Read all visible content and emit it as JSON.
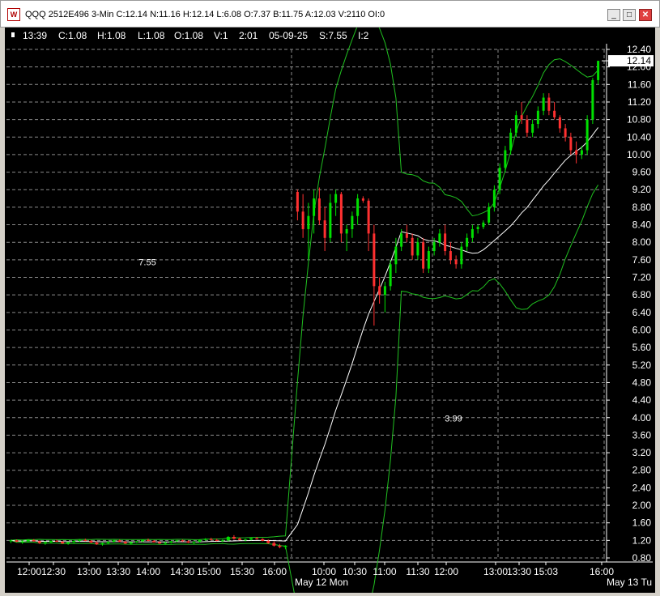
{
  "window": {
    "title": "QQQ 2512E496 3-Min C:12.14 N:11.16 H:12.14 L:6.08 O:7.37 B:11.75 A:12.03 V:2110 OI:0",
    "icon_letter": "W",
    "minimize_label": "_",
    "maximize_label": "□",
    "close_label": "✕"
  },
  "infobar": {
    "time": "13:39",
    "close": "C:1.08",
    "high": "H:1.08",
    "low": "L:1.08",
    "open": "O:1.08",
    "volume": "V:1",
    "bar_time": "2:01",
    "date": "05-09-25",
    "strike": "S:7.55",
    "interval": "I:2"
  },
  "colors": {
    "background": "#000000",
    "grid": "#8a8a8a",
    "up_bar": "#00e000",
    "down_bar": "#ff3030",
    "band": "#20c020",
    "average": "#ffffff"
  },
  "chart_data": {
    "type": "candlestick",
    "title": "",
    "ylim": [
      0.8,
      12.4
    ],
    "y_ticks": [
      "12.40",
      "12.00",
      "11.60",
      "11.20",
      "10.80",
      "10.40",
      "10.00",
      "9.60",
      "9.20",
      "8.80",
      "8.40",
      "8.00",
      "7.60",
      "7.20",
      "6.80",
      "6.40",
      "6.00",
      "5.60",
      "5.20",
      "4.80",
      "4.40",
      "4.00",
      "3.60",
      "3.20",
      "2.80",
      "2.40",
      "2.00",
      "1.60",
      "1.20",
      "0.80"
    ],
    "last_price": "12.14",
    "x_ticks": [
      "12:00",
      "12:30",
      "13:00",
      "13:30",
      "14:00",
      "14:30",
      "15:00",
      "15:30",
      "16:00",
      "10:00",
      "10:30",
      "11:00",
      "11:30",
      "12:00",
      "13:00",
      "13:30",
      "15:03",
      "16:00"
    ],
    "day_labels": [
      "May 12 Mon",
      "May 13 Tu"
    ],
    "annotations": [
      "7.55",
      "3.99"
    ],
    "annotation_values": [
      7.55,
      3.99
    ],
    "bars": [
      [
        1.18,
        1.22,
        1.14,
        1.2
      ],
      [
        1.2,
        1.22,
        1.16,
        1.17
      ],
      [
        1.16,
        1.2,
        1.12,
        1.18
      ],
      [
        1.18,
        1.22,
        1.15,
        1.21
      ],
      [
        1.21,
        1.23,
        1.17,
        1.18
      ],
      [
        1.18,
        1.2,
        1.12,
        1.14
      ],
      [
        1.14,
        1.18,
        1.1,
        1.16
      ],
      [
        1.16,
        1.2,
        1.14,
        1.19
      ],
      [
        1.19,
        1.22,
        1.16,
        1.17
      ],
      [
        1.17,
        1.19,
        1.12,
        1.13
      ],
      [
        1.13,
        1.17,
        1.1,
        1.16
      ],
      [
        1.16,
        1.2,
        1.14,
        1.19
      ],
      [
        1.19,
        1.23,
        1.17,
        1.21
      ],
      [
        1.21,
        1.24,
        1.18,
        1.19
      ],
      [
        1.19,
        1.21,
        1.14,
        1.15
      ],
      [
        1.15,
        1.18,
        1.1,
        1.11
      ],
      [
        1.11,
        1.15,
        1.08,
        1.14
      ],
      [
        1.14,
        1.18,
        1.12,
        1.17
      ],
      [
        1.17,
        1.21,
        1.15,
        1.2
      ],
      [
        1.2,
        1.22,
        1.16,
        1.17
      ],
      [
        1.17,
        1.19,
        1.12,
        1.13
      ],
      [
        1.13,
        1.17,
        1.1,
        1.16
      ],
      [
        1.16,
        1.19,
        1.14,
        1.18
      ],
      [
        1.18,
        1.22,
        1.16,
        1.21
      ],
      [
        1.21,
        1.24,
        1.18,
        1.19
      ],
      [
        1.19,
        1.21,
        1.15,
        1.16
      ],
      [
        1.16,
        1.18,
        1.12,
        1.13
      ],
      [
        1.13,
        1.17,
        1.1,
        1.15
      ],
      [
        1.15,
        1.19,
        1.13,
        1.18
      ],
      [
        1.18,
        1.21,
        1.16,
        1.2
      ],
      [
        1.2,
        1.22,
        1.17,
        1.18
      ],
      [
        1.18,
        1.2,
        1.14,
        1.15
      ],
      [
        1.15,
        1.18,
        1.12,
        1.17
      ],
      [
        1.17,
        1.22,
        1.15,
        1.21
      ],
      [
        1.21,
        1.25,
        1.19,
        1.23
      ],
      [
        1.23,
        1.26,
        1.2,
        1.21
      ],
      [
        1.21,
        1.24,
        1.18,
        1.19
      ],
      [
        1.19,
        1.22,
        1.16,
        1.2
      ],
      [
        1.2,
        1.3,
        1.18,
        1.28
      ],
      [
        1.28,
        1.32,
        1.22,
        1.24
      ],
      [
        1.24,
        1.27,
        1.2,
        1.21
      ],
      [
        1.21,
        1.24,
        1.18,
        1.22
      ],
      [
        1.22,
        1.26,
        1.2,
        1.25
      ],
      [
        1.25,
        1.28,
        1.22,
        1.23
      ],
      [
        1.23,
        1.25,
        1.18,
        1.19
      ],
      [
        1.19,
        1.22,
        1.12,
        1.14
      ],
      [
        1.14,
        1.18,
        1.06,
        1.08
      ],
      [
        1.08,
        1.12,
        1.02,
        1.05
      ],
      [
        1.05,
        1.09,
        1.0,
        1.08
      ],
      [
        9.15,
        9.2,
        8.5,
        8.7
      ],
      [
        8.7,
        9.1,
        8.1,
        8.3
      ],
      [
        8.3,
        8.9,
        7.6,
        8.6
      ],
      [
        8.6,
        9.2,
        8.2,
        9.0
      ],
      [
        9.0,
        9.25,
        8.4,
        8.5
      ],
      [
        8.5,
        8.8,
        7.8,
        8.1
      ],
      [
        8.1,
        9.1,
        8.0,
        8.9
      ],
      [
        8.9,
        9.2,
        8.6,
        9.1
      ],
      [
        9.1,
        9.15,
        8.0,
        8.2
      ],
      [
        8.2,
        8.4,
        7.8,
        8.3
      ],
      [
        8.3,
        8.7,
        8.1,
        8.6
      ],
      [
        8.6,
        9.1,
        8.4,
        9.0
      ],
      [
        9.0,
        9.05,
        8.9,
        8.95
      ],
      [
        8.95,
        9.0,
        7.8,
        8.2
      ],
      [
        8.2,
        8.4,
        6.1,
        7.0
      ],
      [
        7.0,
        7.2,
        6.6,
        6.8
      ],
      [
        6.8,
        7.1,
        6.4,
        7.0
      ],
      [
        7.0,
        7.6,
        6.9,
        7.5
      ],
      [
        7.5,
        8.1,
        7.3,
        7.9
      ],
      [
        7.9,
        8.3,
        7.8,
        8.2
      ],
      [
        8.2,
        8.4,
        8.0,
        8.1
      ],
      [
        8.1,
        8.2,
        7.6,
        7.7
      ],
      [
        7.7,
        8.1,
        7.6,
        8.0
      ],
      [
        8.0,
        8.1,
        7.3,
        7.4
      ],
      [
        7.4,
        7.9,
        7.3,
        7.8
      ],
      [
        7.8,
        8.1,
        7.7,
        8.0
      ],
      [
        8.0,
        8.3,
        7.9,
        8.2
      ],
      [
        8.2,
        8.4,
        7.7,
        7.8
      ],
      [
        7.8,
        8.0,
        7.5,
        7.6
      ],
      [
        7.6,
        7.7,
        7.4,
        7.5
      ],
      [
        7.5,
        8.0,
        7.4,
        7.9
      ],
      [
        7.9,
        8.2,
        7.8,
        8.1
      ],
      [
        8.1,
        8.4,
        8.0,
        8.3
      ],
      [
        8.3,
        8.4,
        8.2,
        8.35
      ],
      [
        8.35,
        8.5,
        8.3,
        8.45
      ],
      [
        8.45,
        8.9,
        8.4,
        8.8
      ],
      [
        8.8,
        9.3,
        8.7,
        9.2
      ],
      [
        9.2,
        9.8,
        9.1,
        9.7
      ],
      [
        9.7,
        10.2,
        9.6,
        10.1
      ],
      [
        10.1,
        10.6,
        10.0,
        10.5
      ],
      [
        10.5,
        11.0,
        10.4,
        10.9
      ],
      [
        10.9,
        11.2,
        10.7,
        10.8
      ],
      [
        10.8,
        10.9,
        10.4,
        10.5
      ],
      [
        10.5,
        10.8,
        10.4,
        10.7
      ],
      [
        10.7,
        11.1,
        10.6,
        11.0
      ],
      [
        11.0,
        11.4,
        10.9,
        11.3
      ],
      [
        11.3,
        11.4,
        10.9,
        11.0
      ],
      [
        11.0,
        11.2,
        10.8,
        10.85
      ],
      [
        10.85,
        10.9,
        10.5,
        10.6
      ],
      [
        10.6,
        10.7,
        10.3,
        10.4
      ],
      [
        10.4,
        10.5,
        10.0,
        10.1
      ],
      [
        10.1,
        10.3,
        9.8,
        10.0
      ],
      [
        10.0,
        10.2,
        9.9,
        10.1
      ],
      [
        10.1,
        10.9,
        10.0,
        10.8
      ],
      [
        10.8,
        11.75,
        10.7,
        11.7
      ],
      [
        11.7,
        12.14,
        11.6,
        12.14
      ]
    ]
  }
}
